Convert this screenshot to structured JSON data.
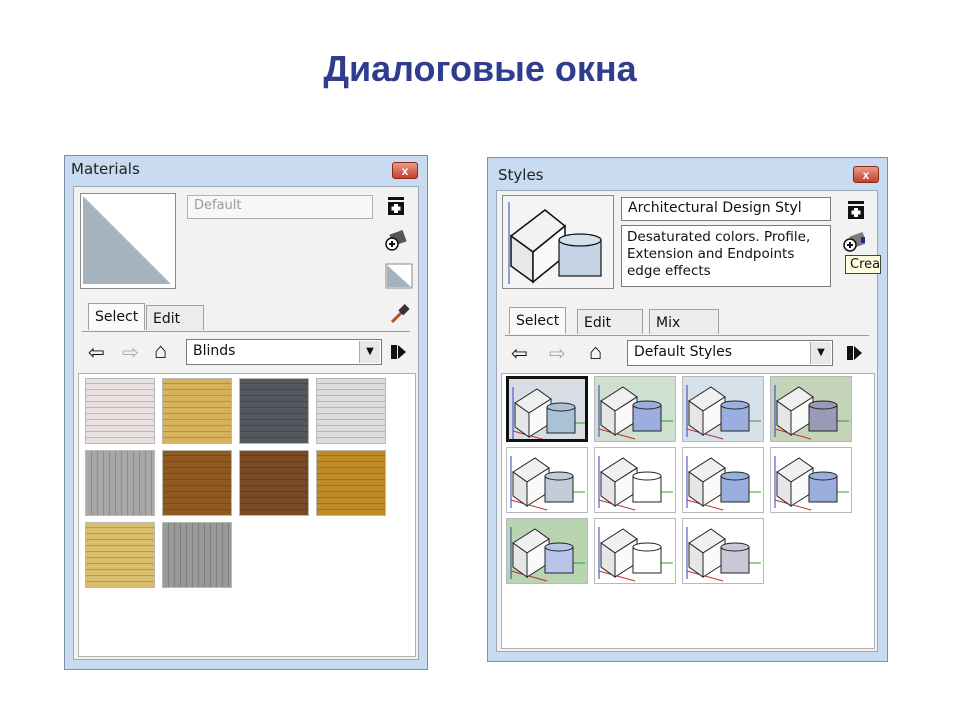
{
  "slide": {
    "title": "Диалоговые окна"
  },
  "materials": {
    "window_title": "Materials",
    "close_label": "x",
    "name_value": "Default",
    "tabs": [
      "Select",
      "Edit"
    ],
    "dropdown_value": "Blinds",
    "swatches": [
      {
        "name": "blinds-white",
        "color": "#e8e1e0"
      },
      {
        "name": "blinds-tan",
        "color": "#d8b25a"
      },
      {
        "name": "blinds-dark-gray",
        "color": "#55585e"
      },
      {
        "name": "blinds-light-gray",
        "color": "#dcdcdc"
      },
      {
        "name": "blinds-silver",
        "color": "#a8a8a8"
      },
      {
        "name": "blinds-wood-brown",
        "color": "#8f5a22"
      },
      {
        "name": "blinds-wood-dark",
        "color": "#7a4a24"
      },
      {
        "name": "blinds-wood-amber",
        "color": "#c08a28"
      },
      {
        "name": "blinds-yellow-stripe",
        "color": "#d9bf6a"
      },
      {
        "name": "blinds-metal",
        "color": "#9a9a9a"
      }
    ]
  },
  "styles": {
    "window_title": "Styles",
    "close_label": "x",
    "style_name": "Architectural Design Styl",
    "description": "Desaturated colors. Profile, Extension and Endpoints edge effects",
    "tooltip": "Crea",
    "tabs": [
      "Select",
      "Edit",
      "Mix"
    ],
    "dropdown_value": "Default Styles",
    "thumbnails": [
      {
        "name": "style-thumb-1",
        "bg": "#d8dde4",
        "cyl": "#a9c2d6"
      },
      {
        "name": "style-thumb-2",
        "bg": "#cfe0d0",
        "cyl": "#9aaee0"
      },
      {
        "name": "style-thumb-3",
        "bg": "#d6e1ea",
        "cyl": "#9aaee0"
      },
      {
        "name": "style-thumb-4",
        "bg": "#c4d4b8",
        "cyl": "#9a9ab8"
      },
      {
        "name": "style-thumb-5",
        "bg": "#ffffff",
        "cyl": "#c0ccd8"
      },
      {
        "name": "style-thumb-6",
        "bg": "#ffffff",
        "cyl": "#ffffff"
      },
      {
        "name": "style-thumb-7",
        "bg": "#ffffff",
        "cyl": "#9aaee0"
      },
      {
        "name": "style-thumb-8",
        "bg": "#ffffff",
        "cyl": "#9aaee0"
      },
      {
        "name": "style-thumb-9",
        "bg": "#b8d4b0",
        "cyl": "#b8c4e8"
      },
      {
        "name": "style-thumb-10",
        "bg": "#ffffff",
        "cyl": "#ffffff"
      },
      {
        "name": "style-thumb-11",
        "bg": "#ffffff",
        "cyl": "#c8c8d8"
      }
    ]
  }
}
